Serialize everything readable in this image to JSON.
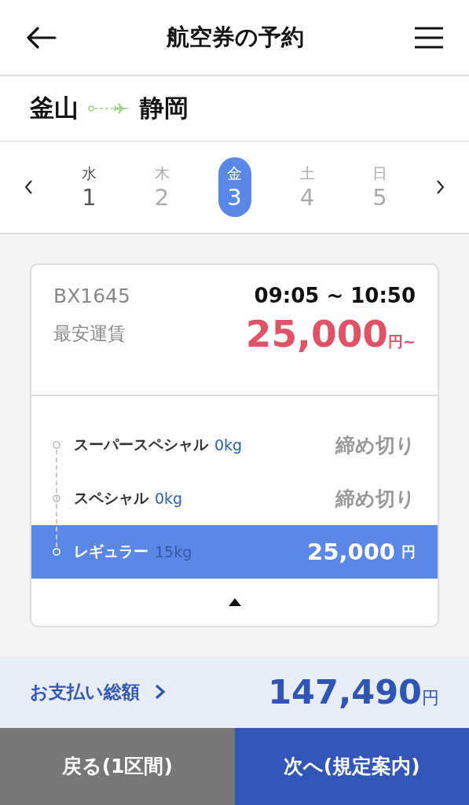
{
  "header": {
    "title": "航空券の予約"
  },
  "route": {
    "from": "釜山",
    "to": "静岡"
  },
  "dates": [
    {
      "weekday": "水",
      "day": "1",
      "selected": false,
      "disabled": false
    },
    {
      "weekday": "木",
      "day": "2",
      "selected": false,
      "disabled": true
    },
    {
      "weekday": "金",
      "day": "3",
      "selected": true,
      "disabled": false
    },
    {
      "weekday": "土",
      "day": "4",
      "selected": false,
      "disabled": true
    },
    {
      "weekday": "日",
      "day": "5",
      "selected": false,
      "disabled": true
    }
  ],
  "flight": {
    "number": "BX1645",
    "time": "09:05  ~ 10:50",
    "lowest_label": "最安運賃",
    "lowest_price": "25,000",
    "lowest_unit": "円~"
  },
  "fares": [
    {
      "kind": "closed",
      "name": "スーパースペシャル",
      "baggage": "0kg",
      "status": "締め切り",
      "selected": false
    },
    {
      "kind": "closed",
      "name": "スペシャル",
      "baggage": "0kg",
      "status": "締め切り",
      "selected": false
    },
    {
      "kind": "price",
      "name": "レギュラー",
      "baggage": "15kg",
      "price": "25,000",
      "unit": "円",
      "selected": true
    }
  ],
  "total": {
    "label": "お支払い総額",
    "amount": "147,490",
    "unit": "円"
  },
  "buttons": {
    "back": "戻る(1区間)",
    "next": "次へ(規定案内)"
  }
}
